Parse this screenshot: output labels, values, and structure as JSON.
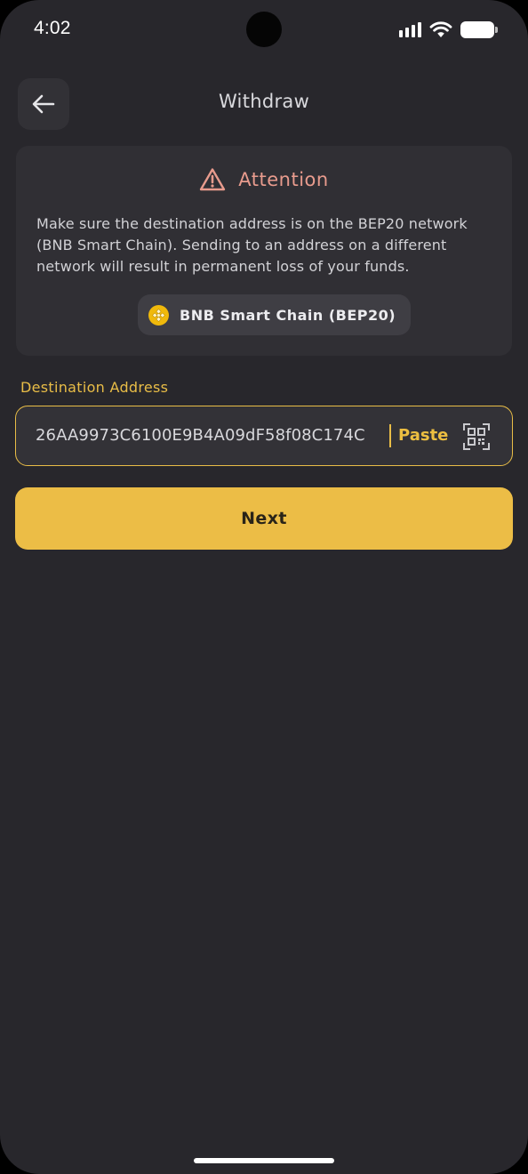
{
  "status_bar": {
    "time": "4:02"
  },
  "header": {
    "title": "Withdraw"
  },
  "attention": {
    "title": "Attention",
    "message": "Make sure the destination address is on the BEP20 network (BNB Smart Chain). Sending to an address on a different network will result in permanent loss of your funds.",
    "network_label": "BNB Smart Chain (BEP20)"
  },
  "address_field": {
    "label": "Destination Address",
    "value": "26AA9973C6100E9B4A09dF58f08C174C",
    "paste_label": "Paste"
  },
  "actions": {
    "next_label": "Next"
  },
  "colors": {
    "background": "#28272c",
    "card": "#302f34",
    "accent": "#ecbd46",
    "warning": "#e89b8d",
    "bnb": "#f0b90b"
  },
  "icons": {
    "back": "arrow-left-icon",
    "warning": "warning-triangle-icon",
    "network": "bnb-coin-icon",
    "scan": "qr-scan-icon"
  }
}
